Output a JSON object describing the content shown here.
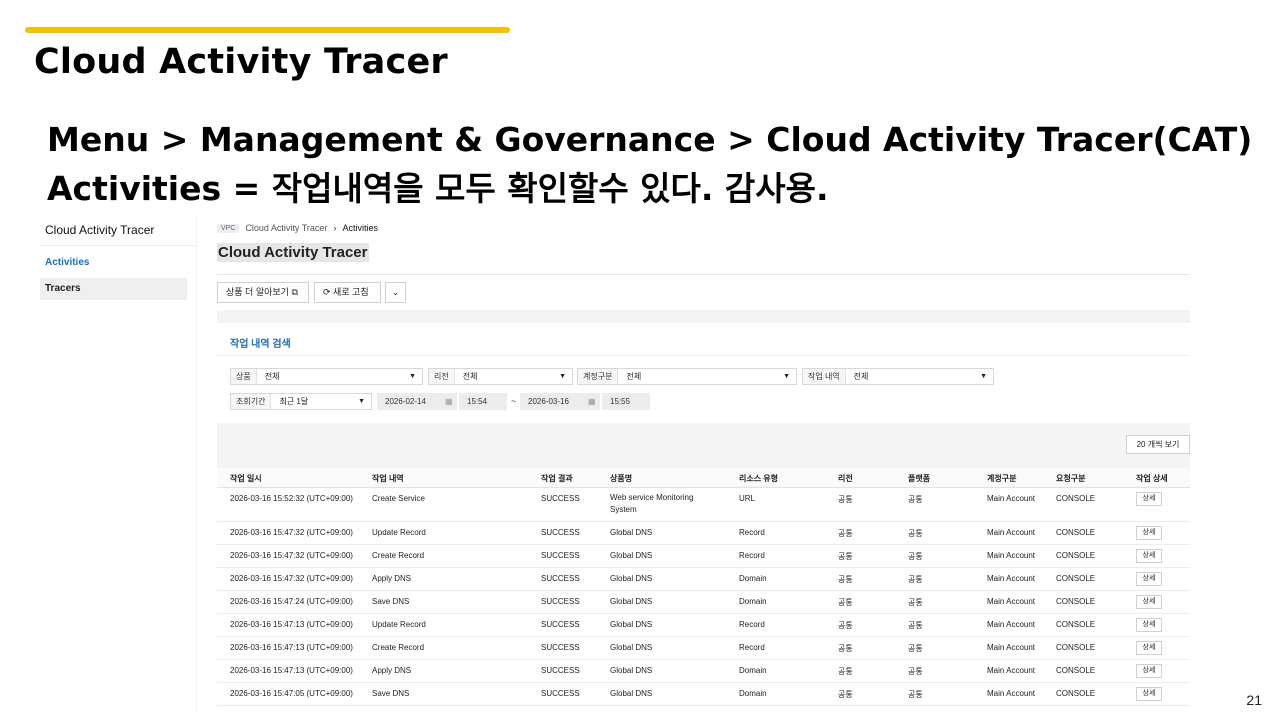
{
  "slide": {
    "title": "Cloud Activity Tracer",
    "line1": "Menu > Management & Governance > Cloud Activity Tracer(CAT)",
    "line2": "Activities  = 작업내역을 모두 확인할수 있다.  감사용.",
    "page_number": "21",
    "accent_color": "#f5c200"
  },
  "sidebar": {
    "title": "Cloud Activity Tracer",
    "items": [
      {
        "label": "Activities"
      },
      {
        "label": "Tracers"
      }
    ]
  },
  "breadcrumb": {
    "tag": "VPC",
    "parent": "Cloud Activity Tracer",
    "current": "Activities"
  },
  "page_title": "Cloud Activity Tracer",
  "toolbar": {
    "more_label": "상품 더 알아보기",
    "refresh_label": "새로 고침"
  },
  "search": {
    "title": "작업 내역 검색",
    "product_label": "상품",
    "product_value": "전체",
    "region_label": "리전",
    "region_value": "전체",
    "account_label": "계정구분",
    "account_value": "전체",
    "task_label": "작업 내역",
    "task_value": "전체",
    "period_label": "조회기간",
    "period_value": "최근 1달",
    "start_date": "2026-02-14",
    "start_time": "15:54",
    "end_date": "2026-03-16",
    "end_time": "15:55",
    "tilde": "~"
  },
  "per_page": "20 개씩 보기",
  "table": {
    "headers": [
      "작업 일시",
      "작업 내역",
      "작업 결과",
      "상품명",
      "리소스 유형",
      "리전",
      "플랫폼",
      "계정구분",
      "요청구분",
      "작업 상세"
    ],
    "detail_label": "상세",
    "rows": [
      [
        "2026-03-16 15:52:32 (UTC+09:00)",
        "Create Service",
        "SUCCESS",
        "Web service Monitoring System",
        "URL",
        "공통",
        "공통",
        "Main Account",
        "CONSOLE"
      ],
      [
        "2026-03-16 15:47:32 (UTC+09:00)",
        "Update Record",
        "SUCCESS",
        "Global DNS",
        "Record",
        "공통",
        "공통",
        "Main Account",
        "CONSOLE"
      ],
      [
        "2026-03-16 15:47:32 (UTC+09:00)",
        "Create Record",
        "SUCCESS",
        "Global DNS",
        "Record",
        "공통",
        "공통",
        "Main Account",
        "CONSOLE"
      ],
      [
        "2026-03-16 15:47:32 (UTC+09:00)",
        "Apply DNS",
        "SUCCESS",
        "Global DNS",
        "Domain",
        "공통",
        "공통",
        "Main Account",
        "CONSOLE"
      ],
      [
        "2026-03-16 15:47:24 (UTC+09:00)",
        "Save DNS",
        "SUCCESS",
        "Global DNS",
        "Domain",
        "공통",
        "공통",
        "Main Account",
        "CONSOLE"
      ],
      [
        "2026-03-16 15:47:13 (UTC+09:00)",
        "Update Record",
        "SUCCESS",
        "Global DNS",
        "Record",
        "공통",
        "공통",
        "Main Account",
        "CONSOLE"
      ],
      [
        "2026-03-16 15:47:13 (UTC+09:00)",
        "Create Record",
        "SUCCESS",
        "Global DNS",
        "Record",
        "공통",
        "공통",
        "Main Account",
        "CONSOLE"
      ],
      [
        "2026-03-16 15:47:13 (UTC+09:00)",
        "Apply DNS",
        "SUCCESS",
        "Global DNS",
        "Domain",
        "공통",
        "공통",
        "Main Account",
        "CONSOLE"
      ],
      [
        "2026-03-16 15:47:05 (UTC+09:00)",
        "Save DNS",
        "SUCCESS",
        "Global DNS",
        "Domain",
        "공통",
        "공통",
        "Main Account",
        "CONSOLE"
      ]
    ]
  }
}
